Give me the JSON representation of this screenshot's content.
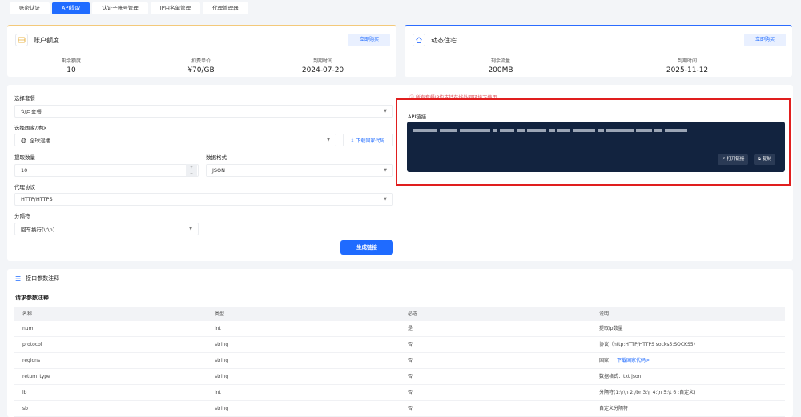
{
  "tabs": [
    {
      "label": "账密认证",
      "active": false
    },
    {
      "label": "API提取",
      "active": true
    },
    {
      "label": "认证子账号管理",
      "active": false
    },
    {
      "label": "IP白名单管理",
      "active": false
    },
    {
      "label": "代理管理器",
      "active": false
    }
  ],
  "quota": {
    "title": "账户额度",
    "buy_label": "立即购买",
    "stats": [
      {
        "label": "剩余额度",
        "value": "10"
      },
      {
        "label": "扣费单价",
        "value": "¥70/GB"
      },
      {
        "label": "到期时间",
        "value": "2024-07-20"
      }
    ]
  },
  "residential": {
    "title": "动态住宅",
    "buy_label": "立即购买",
    "stats": [
      {
        "label": "剩余流量",
        "value": "200MB"
      },
      {
        "label": "到期时间",
        "value": "2025-11-12"
      }
    ]
  },
  "form": {
    "package_label": "选择套餐",
    "package_value": "包月套餐",
    "region_label": "选择国家/地区",
    "region_value": "全球混播",
    "download_codes_label": "下载国家代码",
    "quantity_label": "提取数量",
    "quantity_value": "10",
    "format_label": "数据格式",
    "format_value": "JSON",
    "protocol_label": "代理协议",
    "protocol_value": "HTTP/HTTPS",
    "separator_label": "分隔符",
    "separator_value": "回车换行(\\r\\n)",
    "generate_label": "生成链接"
  },
  "api": {
    "notice": "ⓘ 所有套餐IP均支持在线外网环境下使用",
    "label": "API链接",
    "open_label": "打开链接",
    "copy_label": "复制"
  },
  "params": {
    "section_title": "接口参数注释",
    "table_title": "请求参数注释",
    "columns": [
      "名称",
      "类型",
      "必选",
      "说明"
    ],
    "rows": [
      {
        "name": "num",
        "type": "int",
        "required": "是",
        "desc": "提取ip数量",
        "link": ""
      },
      {
        "name": "protocol",
        "type": "string",
        "required": "否",
        "desc": "协议（http:HTTP/HTTPS socks5:SOCKS5）",
        "link": ""
      },
      {
        "name": "regions",
        "type": "string",
        "required": "否",
        "desc": "国家",
        "link": "下载国家代码>"
      },
      {
        "name": "return_type",
        "type": "string",
        "required": "否",
        "desc": "数据格式：txt json",
        "link": ""
      },
      {
        "name": "lb",
        "type": "int",
        "required": "否",
        "desc": "分隔符(1:\\r\\n 2:/br 3:\\r 4:\\n 5:\\t 6 :自定义)",
        "link": ""
      },
      {
        "name": "sb",
        "type": "string",
        "required": "否",
        "desc": "自定义分隔符",
        "link": ""
      }
    ]
  },
  "colors": {
    "accent": "#1f6bff",
    "warning": "#e01e1e",
    "api_bg": "#12233f"
  }
}
